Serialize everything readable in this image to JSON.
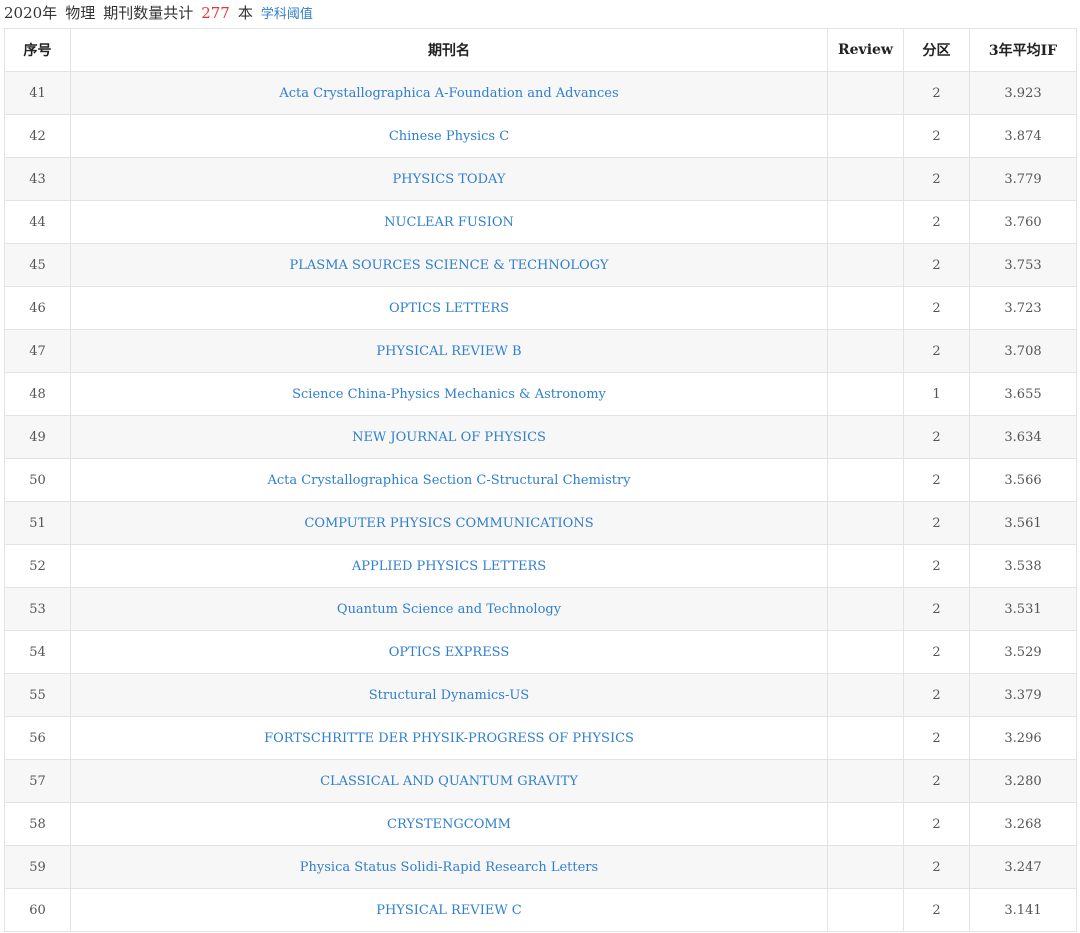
{
  "summary": {
    "year_label": "2020年",
    "subject": "物理",
    "count_prefix": "期刊数量共计",
    "count": "277",
    "count_suffix": "本",
    "threshold_link": "学科阈值"
  },
  "table": {
    "headers": {
      "index": "序号",
      "journal": "期刊名",
      "review": "Review",
      "zone": "分区",
      "if3": "3年平均IF"
    },
    "rows": [
      {
        "index": "41",
        "journal": "Acta Crystallographica A-Foundation and Advances",
        "review": "",
        "zone": "2",
        "if3": "3.923"
      },
      {
        "index": "42",
        "journal": "Chinese Physics C",
        "review": "",
        "zone": "2",
        "if3": "3.874"
      },
      {
        "index": "43",
        "journal": "PHYSICS TODAY",
        "review": "",
        "zone": "2",
        "if3": "3.779"
      },
      {
        "index": "44",
        "journal": "NUCLEAR FUSION",
        "review": "",
        "zone": "2",
        "if3": "3.760"
      },
      {
        "index": "45",
        "journal": "PLASMA SOURCES SCIENCE & TECHNOLOGY",
        "review": "",
        "zone": "2",
        "if3": "3.753"
      },
      {
        "index": "46",
        "journal": "OPTICS LETTERS",
        "review": "",
        "zone": "2",
        "if3": "3.723"
      },
      {
        "index": "47",
        "journal": "PHYSICAL REVIEW B",
        "review": "",
        "zone": "2",
        "if3": "3.708"
      },
      {
        "index": "48",
        "journal": "Science China-Physics Mechanics & Astronomy",
        "review": "",
        "zone": "1",
        "if3": "3.655"
      },
      {
        "index": "49",
        "journal": "NEW JOURNAL OF PHYSICS",
        "review": "",
        "zone": "2",
        "if3": "3.634"
      },
      {
        "index": "50",
        "journal": "Acta Crystallographica Section C-Structural Chemistry",
        "review": "",
        "zone": "2",
        "if3": "3.566"
      },
      {
        "index": "51",
        "journal": "COMPUTER PHYSICS COMMUNICATIONS",
        "review": "",
        "zone": "2",
        "if3": "3.561"
      },
      {
        "index": "52",
        "journal": "APPLIED PHYSICS LETTERS",
        "review": "",
        "zone": "2",
        "if3": "3.538"
      },
      {
        "index": "53",
        "journal": "Quantum Science and Technology",
        "review": "",
        "zone": "2",
        "if3": "3.531"
      },
      {
        "index": "54",
        "journal": "OPTICS EXPRESS",
        "review": "",
        "zone": "2",
        "if3": "3.529"
      },
      {
        "index": "55",
        "journal": "Structural Dynamics-US",
        "review": "",
        "zone": "2",
        "if3": "3.379"
      },
      {
        "index": "56",
        "journal": "FORTSCHRITTE DER PHYSIK-PROGRESS OF PHYSICS",
        "review": "",
        "zone": "2",
        "if3": "3.296"
      },
      {
        "index": "57",
        "journal": "CLASSICAL AND QUANTUM GRAVITY",
        "review": "",
        "zone": "2",
        "if3": "3.280"
      },
      {
        "index": "58",
        "journal": "CRYSTENGCOMM",
        "review": "",
        "zone": "2",
        "if3": "3.268"
      },
      {
        "index": "59",
        "journal": "Physica Status Solidi-Rapid Research Letters",
        "review": "",
        "zone": "2",
        "if3": "3.247"
      },
      {
        "index": "60",
        "journal": "PHYSICAL REVIEW C",
        "review": "",
        "zone": "2",
        "if3": "3.141"
      }
    ]
  },
  "colors": {
    "link": "#2f7fcf",
    "count": "#e8343a",
    "row_stripe": "#f7f7f7",
    "border": "#e3e3e3"
  }
}
